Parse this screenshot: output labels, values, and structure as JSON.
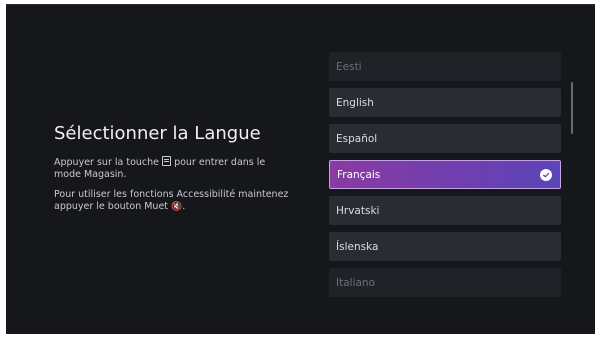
{
  "left": {
    "title": "Sélectionner la Langue",
    "hint1_pre": "Appuyer sur la touche",
    "hint1_post": "pour entrer dans le mode Magasin.",
    "hint2_pre": "Pour utiliser les fonctions Accessibilité maintenez appuyer le bouton Muet",
    "hint2_post": "."
  },
  "languages": [
    {
      "label": "Eesti",
      "state": "faded"
    },
    {
      "label": "English",
      "state": "normal"
    },
    {
      "label": "Español",
      "state": "normal"
    },
    {
      "label": "Français",
      "state": "selected"
    },
    {
      "label": "Hrvatski",
      "state": "normal"
    },
    {
      "label": "Íslenska",
      "state": "normal"
    },
    {
      "label": "Italiano",
      "state": "faded"
    }
  ],
  "icons": {
    "key": "guide-key-icon",
    "mute": "mute-icon",
    "check": "checkmark-icon"
  },
  "colors": {
    "background": "#16171b",
    "item": "#2a2c33",
    "selected_start": "#8a3aa3",
    "selected_end": "#5a46b8"
  }
}
